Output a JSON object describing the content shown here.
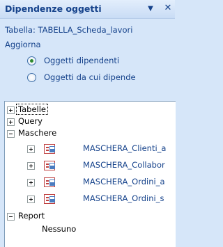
{
  "panel": {
    "title": "Dipendenze oggetti",
    "menu_icon": "dropdown-arrow-icon",
    "close_icon": "close-icon"
  },
  "table_link": "Tabella: TABELLA_Scheda_lavori",
  "refresh_link": "Aggiorna",
  "options": [
    {
      "label": "Oggetti dipendenti",
      "selected": true
    },
    {
      "label": "Oggetti da cui dipende",
      "selected": false
    }
  ],
  "tree": {
    "tables": "Tabelle",
    "queries": "Query",
    "forms": "Maschere",
    "form_items": [
      "MASCHERA_Clienti_a",
      "MASCHERA_Collabor",
      "MASCHERA_Ordini_a",
      "MASCHERA_Ordini_s"
    ],
    "reports": "Report",
    "none": "Nessuno"
  },
  "colors": {
    "panel_bg": "#d6e6f9",
    "link": "#15428b"
  }
}
